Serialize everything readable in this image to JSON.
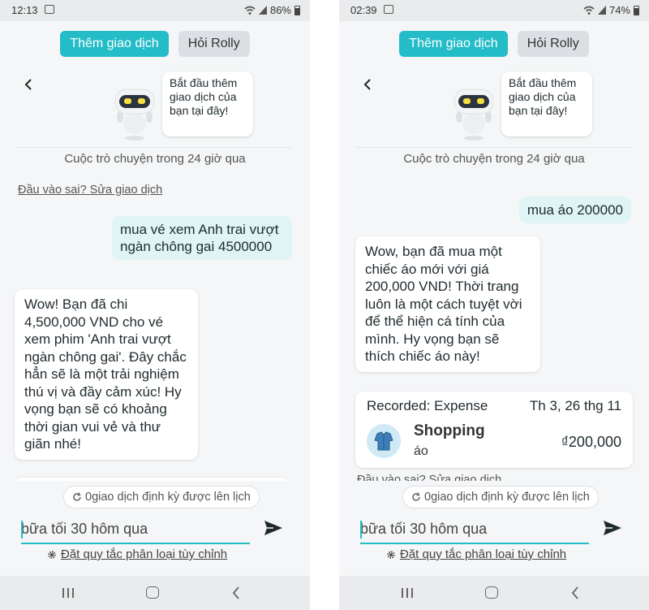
{
  "left": {
    "status": {
      "time": "12:13",
      "battery": "86%"
    },
    "tabs": {
      "add": "Thêm giao dịch",
      "ask": "Hỏi Rolly"
    },
    "bot_greeting": "Bắt đầu thêm giao dịch của bạn tại đây!",
    "history_label": "Cuộc trò chuyện trong 24 giờ qua",
    "wrong_input": "Đầu vào sai? Sửa giao dịch",
    "user_message": "mua vé xem Anh trai vượt ngàn chông gai 4500000",
    "ai_message": "Wow! Bạn đã chi 4,500,000 VND cho vé xem phim 'Anh trai vượt ngàn chông gai'. Đây chắc hẳn sẽ là một trải nghiệm thú vị và đầy cảm xúc! Hy vọng bạn sẽ có khoảng thời gian vui vẻ và thư giãn nhé!",
    "recurring": "0giao dịch định kỳ được lên lịch",
    "input_value": "bữa tối 30 hôm qua",
    "rules_link": "Đặt quy tắc phân loại tùy chỉnh"
  },
  "right": {
    "status": {
      "time": "02:39",
      "battery": "74%"
    },
    "tabs": {
      "add": "Thêm giao dịch",
      "ask": "Hỏi Rolly"
    },
    "bot_greeting": "Bắt đầu thêm giao dịch của bạn tại đây!",
    "history_label": "Cuộc trò chuyện trong 24 giờ qua",
    "wrong_input": "Đầu vào sai? Sửa giao dịch",
    "user_message": "mua áo 200000",
    "ai_message": "Wow, bạn đã mua một chiếc áo mới với giá 200,000 VND! Thời trang luôn là một cách tuyệt vời để thể hiện cá tính của mình. Hy vọng bạn sẽ thích chiếc áo này!",
    "transaction": {
      "recorded": "Recorded: Expense",
      "date": "Th 3, 26 thg 11",
      "category": "Shopping",
      "note": "áo",
      "amount": "₫200,000",
      "icon": "shirt-icon"
    },
    "recurring": "0giao dịch định kỳ được lên lịch",
    "input_value": "bữa tối 30 hôm qua",
    "rules_link": "Đặt quy tắc phân loại tùy chỉnh"
  },
  "colors": {
    "accent": "#24bcc7",
    "user_bubble": "#dff4f5",
    "background": "#f5f6f7",
    "bars": "#e9ebec"
  }
}
